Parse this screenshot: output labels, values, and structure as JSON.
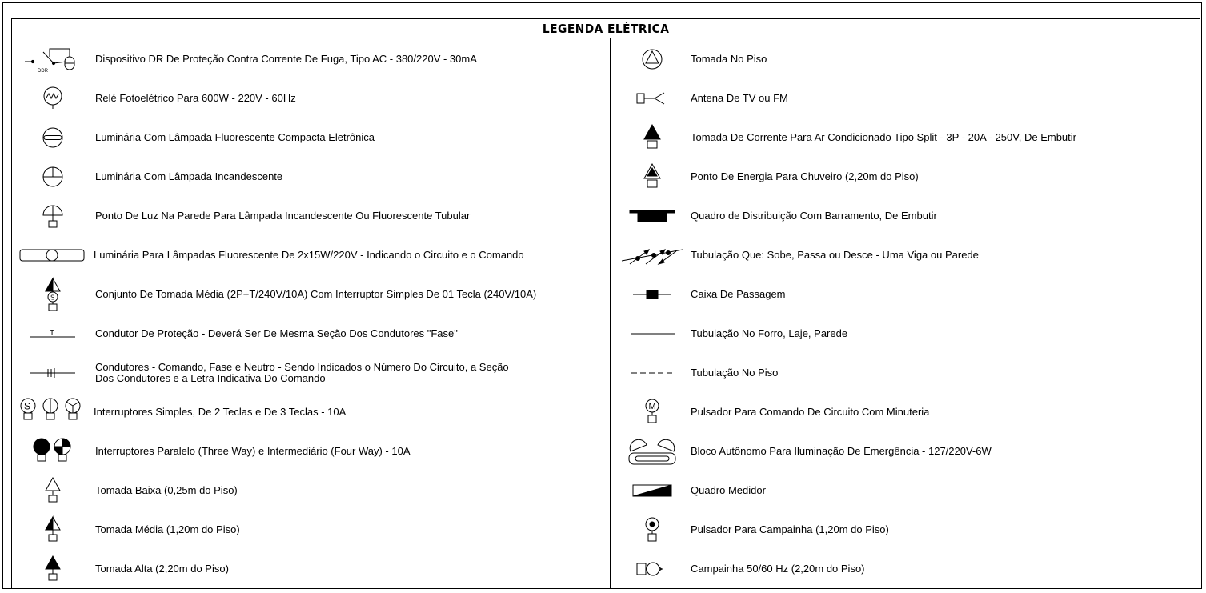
{
  "legend": {
    "title": "LEGENDA ELÉTRICA",
    "left": [
      {
        "icon": "ddr-device-icon",
        "label": "Dispositivo DR De Proteção Contra Corrente De Fuga, Tipo AC - 380/220V - 30mA",
        "tag": "DDR"
      },
      {
        "icon": "photoelectric-relay-icon",
        "label": "Relé Fotoelétrico Para 600W - 220V - 60Hz"
      },
      {
        "icon": "fluorescent-luminaire-icon",
        "label": "Luminária Com Lâmpada Fluorescente Compacta Eletrônica"
      },
      {
        "icon": "incandescent-luminaire-icon",
        "label": "Luminária Com Lâmpada Incandescente"
      },
      {
        "icon": "wall-light-point-icon",
        "label": "Ponto De Luz Na Parede Para Lâmpada Incandescente Ou Fluorescente Tubular"
      },
      {
        "icon": "tube-luminaire-icon",
        "label": "Luminária Para Lâmpadas Fluorescente De 2x15W/220V - Indicando o Circuito e o Comando"
      },
      {
        "icon": "outlet-switch-set-icon",
        "label": "Conjunto De Tomada Média (2P+T/240V/10A) Com Interruptor Simples De 01 Tecla (240V/10A)"
      },
      {
        "icon": "ground-conductor-icon",
        "label": "Condutor De Proteção - Deverá Ser De Mesma Seção Dos Condutores \"Fase\"",
        "tag": "T"
      },
      {
        "icon": "conductors-icon",
        "label": "Condutores - Comando, Fase e Neutro - Sendo Indicados o Número Do Circuito, a Seção\nDos Condutores e a Letra Indicativa Do Comando"
      },
      {
        "icon": "simple-switches-icon",
        "label": "Interruptores Simples, De 2 Teclas e De 3 Teclas - 10A"
      },
      {
        "icon": "three-four-way-switches-icon",
        "label": "Interruptores Paralelo (Three Way) e Intermediário (Four Way) - 10A"
      },
      {
        "icon": "low-outlet-icon",
        "label": "Tomada Baixa (0,25m do Piso)"
      },
      {
        "icon": "medium-outlet-icon",
        "label": "Tomada Média (1,20m do Piso)"
      },
      {
        "icon": "high-outlet-icon",
        "label": "Tomada Alta (2,20m do Piso)"
      }
    ],
    "right": [
      {
        "icon": "floor-outlet-icon",
        "label": "Tomada No Piso"
      },
      {
        "icon": "antenna-icon",
        "label": "Antena De TV ou FM"
      },
      {
        "icon": "split-ac-outlet-icon",
        "label": "Tomada De Corrente Para Ar Condicionado Tipo Split - 3P - 20A - 250V, De Embutir"
      },
      {
        "icon": "shower-outlet-icon",
        "label": "Ponto De Energia Para Chuveiro (2,20m do Piso)"
      },
      {
        "icon": "distribution-board-icon",
        "label": "Quadro de Distribuição Com Barramento, De Embutir"
      },
      {
        "icon": "conduit-crossing-icon",
        "label": "Tubulação Que: Sobe, Passa ou Desce - Uma Viga ou Parede"
      },
      {
        "icon": "junction-box-icon",
        "label": "Caixa De Passagem"
      },
      {
        "icon": "ceiling-conduit-icon",
        "label": "Tubulação No Forro, Laje, Parede"
      },
      {
        "icon": "floor-conduit-icon",
        "label": "Tubulação No Piso"
      },
      {
        "icon": "timer-push-button-icon",
        "label": "Pulsador Para Comando De Circuito Com Minuteria",
        "tag": "M"
      },
      {
        "icon": "emergency-light-icon",
        "label": "Bloco Autônomo Para Iluminação De Emergência - 127/220V-6W"
      },
      {
        "icon": "meter-board-icon",
        "label": "Quadro Medidor"
      },
      {
        "icon": "doorbell-button-icon",
        "label": "Pulsador Para Campainha (1,20m do Piso)"
      },
      {
        "icon": "doorbell-icon",
        "label": "Campainha 50/60 Hz (2,20m do Piso)"
      }
    ]
  }
}
